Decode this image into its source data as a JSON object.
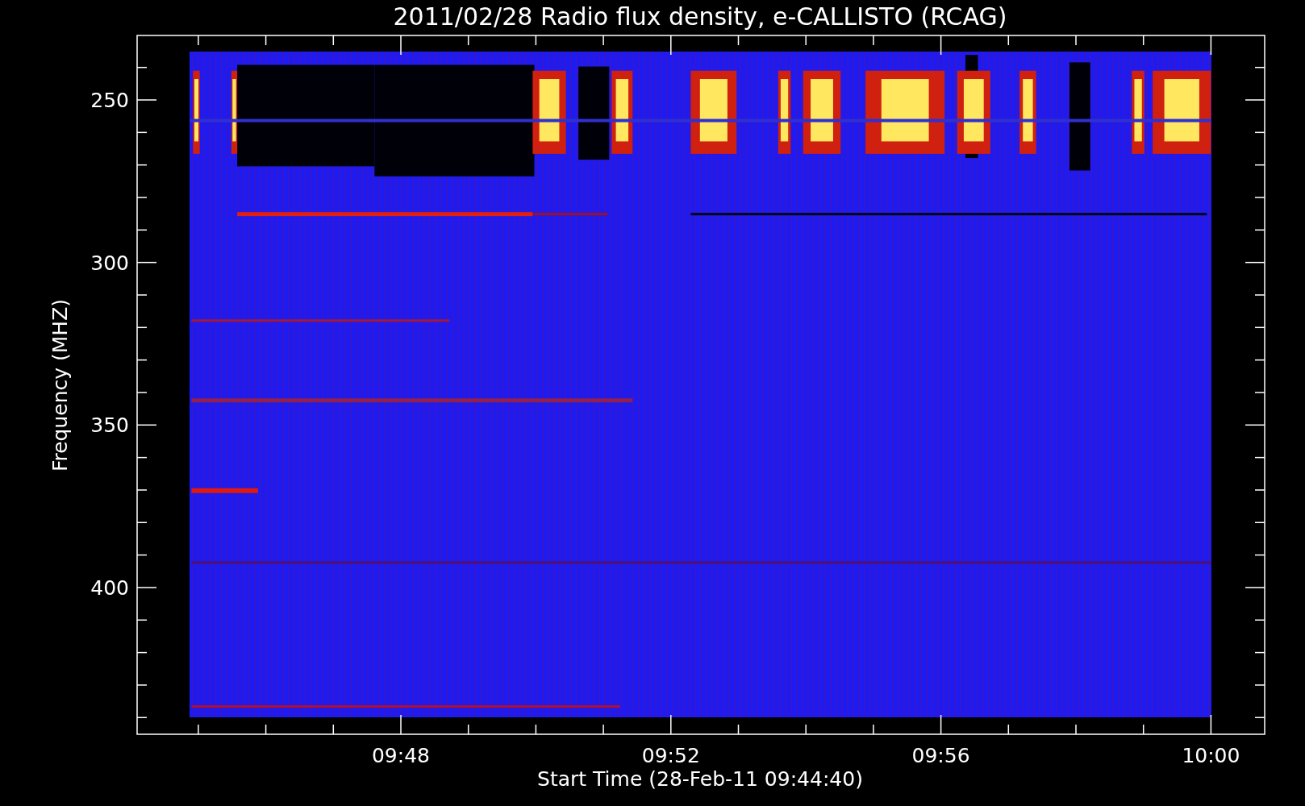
{
  "title": "2011/02/28  Radio flux density, e-CALLISTO (RCAG)",
  "y_axis": {
    "label": "Frequency (MHZ)",
    "ticks": [
      "250",
      "300",
      "350",
      "400"
    ]
  },
  "x_axis": {
    "label": "Start Time (28-Feb-11 09:44:40)",
    "ticks": [
      "09:48",
      "09:52",
      "09:56",
      "10:00"
    ]
  }
}
